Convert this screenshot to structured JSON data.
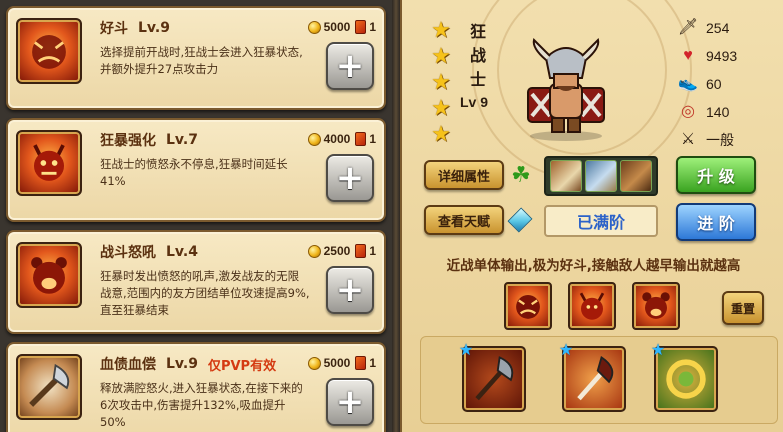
{
  "skills": [
    {
      "name": "好斗",
      "level": "Lv.9",
      "cost": "5000",
      "books": "1",
      "pvp_tag": "",
      "desc": "选择提前开战时,狂战士会进入狂暴状态,并额外提升27点攻击力"
    },
    {
      "name": "狂暴强化",
      "level": "Lv.7",
      "cost": "4000",
      "books": "1",
      "pvp_tag": "",
      "desc": "狂战士的愤怒永不停息,狂暴时间延长41%"
    },
    {
      "name": "战斗怒吼",
      "level": "Lv.4",
      "cost": "2500",
      "books": "1",
      "pvp_tag": "",
      "desc": "狂暴时发出愤怒的吼声,激发战友的无限战意,范围内的友方团结单位攻速提高9%,直至狂暴结束"
    },
    {
      "name": "血债血偿",
      "level": "Lv.9",
      "cost": "5000",
      "books": "1",
      "pvp_tag": "仅PVP有效",
      "desc": "释放满腔怒火,进入狂暴状态,在接下来的6次攻击中,伤害提升132%,吸血提升50%"
    }
  ],
  "hero": {
    "name_chars": [
      "狂",
      "战",
      "士"
    ],
    "level": "Lv 9",
    "stars": 5,
    "stats": {
      "attack": "254",
      "hp": "9493",
      "speed": "60",
      "range": "140",
      "attack_speed": "一般"
    },
    "buttons": {
      "detail": "详细属性",
      "talent": "查看天赋",
      "upgrade": "升 级",
      "advance": "进 阶",
      "reset": "重置"
    },
    "maxed": "已满阶",
    "description": "近战单体输出,极为好斗,接触敌人越早输出就越高"
  },
  "colors": {
    "panel_bg": "#f2dfae",
    "upgrade_green": "#3aa320",
    "advance_blue": "#2d78d7",
    "maxed_text": "#2c62c9",
    "pvp_tag": "#d43a11"
  },
  "icons": {
    "stats": [
      "sword-icon",
      "heart-icon",
      "boot-icon",
      "target-icon",
      "dual-swords-icon"
    ],
    "equipment": [
      "scroll-icon",
      "stone-icon",
      "claw-icon"
    ]
  }
}
